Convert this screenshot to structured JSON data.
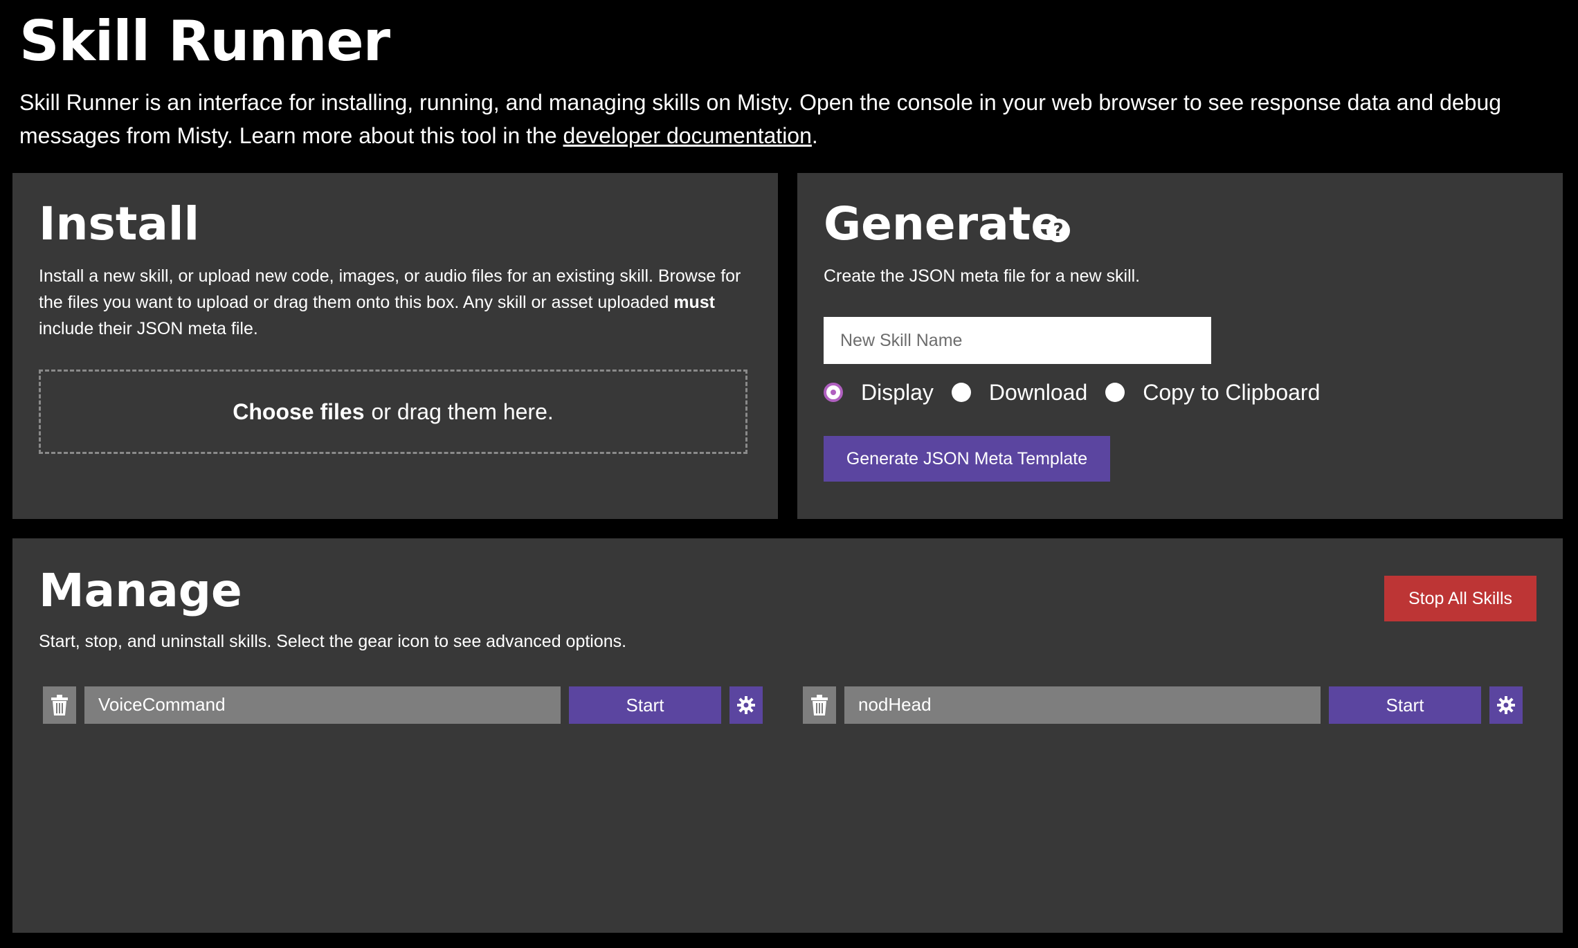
{
  "page": {
    "title": "Skill Runner",
    "intro_text": "Skill Runner is an interface for installing, running, and managing skills on Misty. Open the console in your web browser to see response data and debug messages from Misty. Learn more about this tool in the ",
    "doc_link_text": "developer documentation",
    "intro_end": "."
  },
  "install": {
    "title": "Install",
    "desc_part1": "Install a new skill, or upload new code, images, or audio files for an existing skill. Browse for the files you want to upload or drag them onto this box. Any skill or asset uploaded ",
    "desc_bold": "must",
    "desc_part2": " include their JSON meta file.",
    "choose_files": "Choose files",
    "drag_text": "or drag them here."
  },
  "generate": {
    "title": "Generate",
    "help_icon": "question-circle-icon",
    "desc": "Create the JSON meta file for a new skill.",
    "input_value": "",
    "input_placeholder": "New Skill Name",
    "options": [
      "Display",
      "Download",
      "Copy to Clipboard"
    ],
    "selected_option": "Display",
    "button_label": "Generate JSON Meta Template"
  },
  "manage": {
    "title": "Manage",
    "desc": "Start, stop, and uninstall skills. Select the gear icon to see advanced options.",
    "stop_all_label": "Stop All Skills",
    "skills": [
      {
        "name": "VoiceCommand",
        "start_label": "Start",
        "delete_icon": "trash-icon",
        "settings_icon": "gear-icon"
      },
      {
        "name": "nodHead",
        "start_label": "Start",
        "delete_icon": "trash-icon",
        "settings_icon": "gear-icon"
      }
    ]
  },
  "colors": {
    "background": "#000000",
    "panel": "#383838",
    "accent_purple": "#5b45a0",
    "danger_red": "#bd3535",
    "skill_field": "#7e7e7e",
    "radio_selected": "#b060c0"
  }
}
